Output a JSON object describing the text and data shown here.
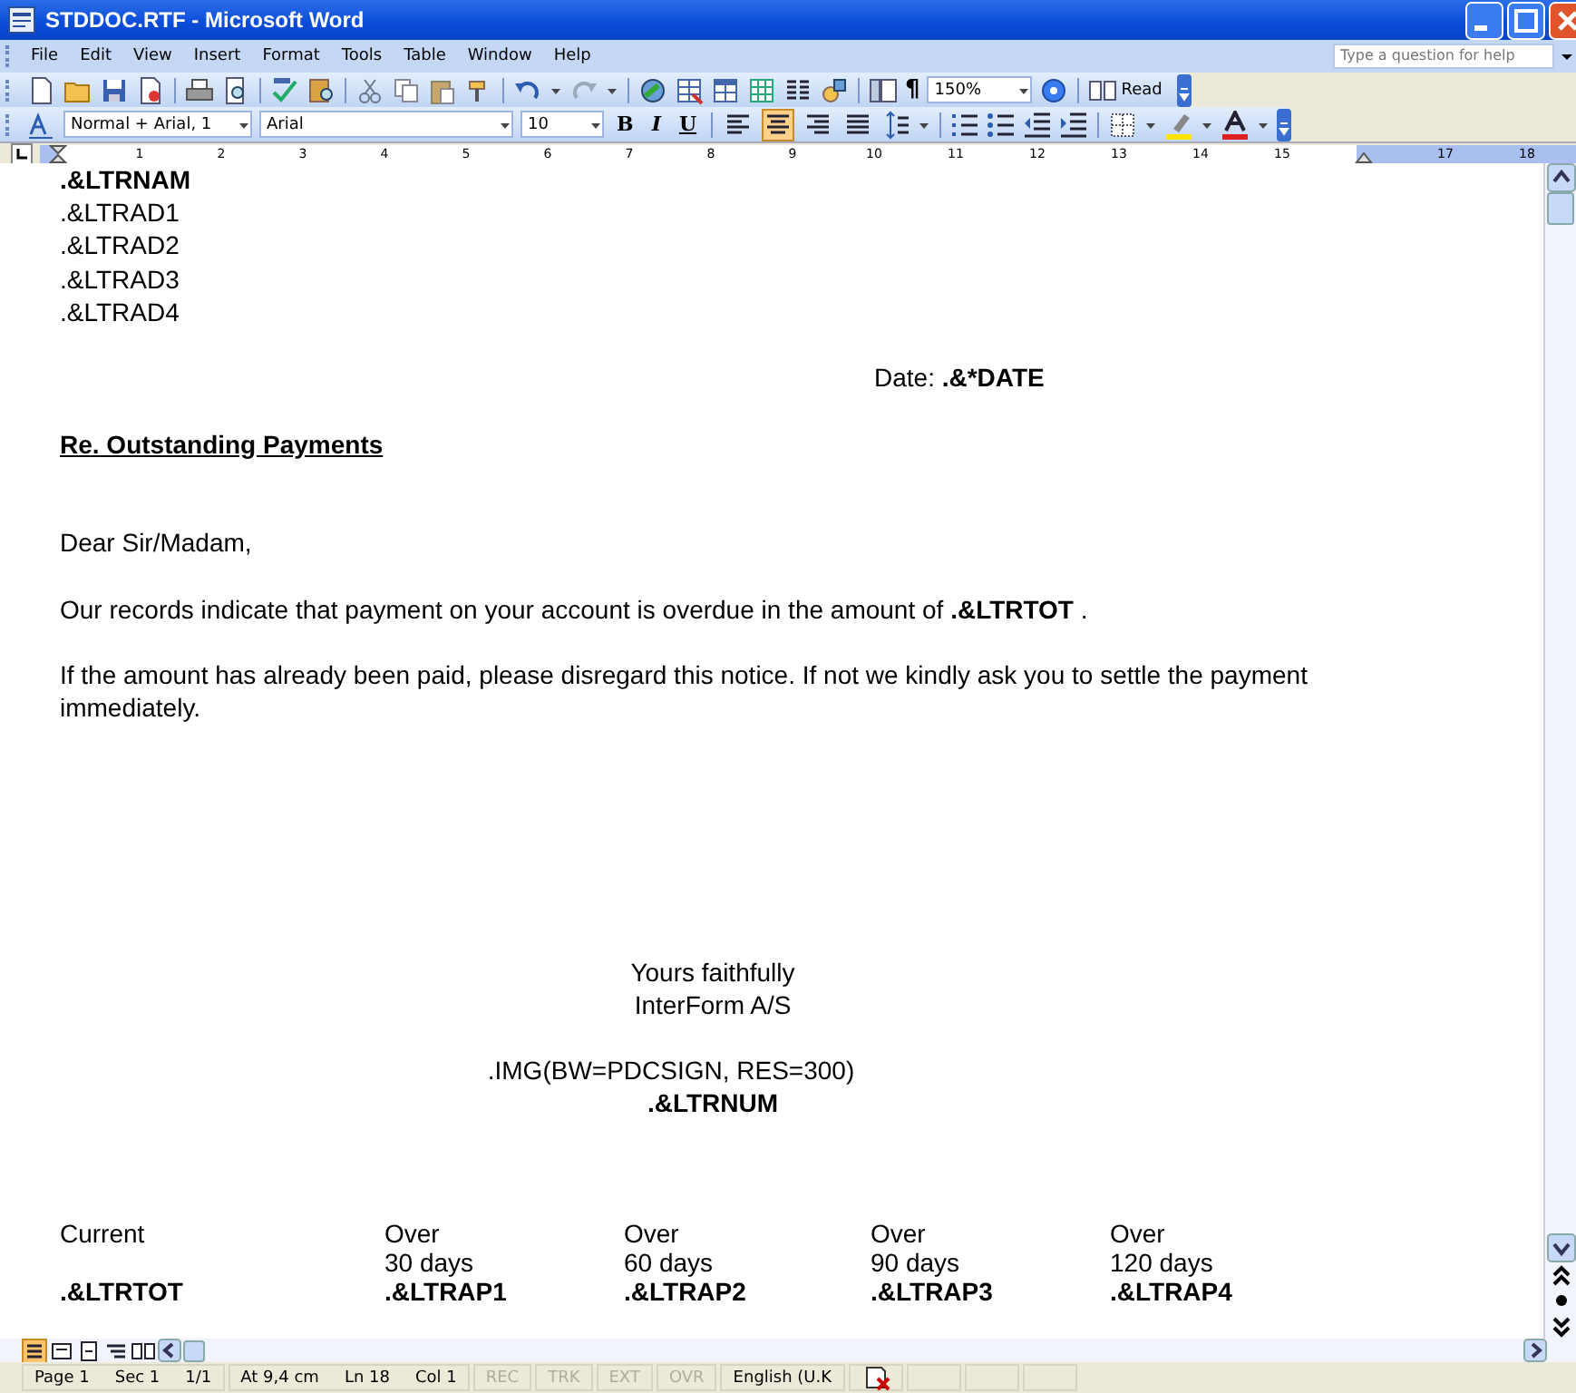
{
  "window": {
    "title": "STDDOC.RTF - Microsoft Word"
  },
  "menu": [
    "File",
    "Edit",
    "View",
    "Insert",
    "Format",
    "Tools",
    "Table",
    "Window",
    "Help"
  ],
  "help_box": {
    "placeholder": "Type a question for help"
  },
  "standard_toolbar": {
    "pilcrow": "¶",
    "zoom": "150%",
    "read": "Read"
  },
  "formatting_toolbar": {
    "style": "Normal + Arial, 1",
    "font": "Arial",
    "size": "10",
    "bold": "B",
    "italic": "I",
    "underline": "U",
    "align_buttons": [
      {
        "selected": false
      },
      {
        "selected": true
      },
      {
        "selected": false
      },
      {
        "selected": false
      }
    ]
  },
  "ruler": [
    "1",
    "2",
    "3",
    "4",
    "5",
    "6",
    "7",
    "8",
    "9",
    "10",
    "11",
    "12",
    "13",
    "14",
    "15",
    "17",
    "18"
  ],
  "document": {
    "paragraphs": [
      {
        "kind": "line",
        "text": ".&LTRNAM",
        "bold": true
      },
      {
        "kind": "line",
        "text": ".&LTRAD1",
        "bold": false
      },
      {
        "kind": "line",
        "text": ".&LTRAD2",
        "bold": false
      },
      {
        "kind": "line",
        "text": ".&LTRAD3",
        "bold": false
      },
      {
        "kind": "line",
        "text": ".&LTRAD4",
        "bold": false
      },
      {
        "kind": "empty"
      },
      {
        "kind": "date",
        "text": "Date: **.&*DATE**",
        "bold": false
      },
      {
        "kind": "empty"
      },
      {
        "kind": "heading",
        "text": "Re. Outstanding Payments",
        "bold": true
      },
      {
        "kind": "empty"
      },
      {
        "kind": "empty"
      },
      {
        "kind": "line",
        "text": "Dear Sir/Madam,",
        "bold": false
      },
      {
        "kind": "empty"
      },
      {
        "kind": "line",
        "text": "Our records indicate that payment on your account is overdue in the amount of **.&LTRTOT** .",
        "bold": false
      },
      {
        "kind": "empty"
      },
      {
        "kind": "line",
        "text": "If the amount has already been paid, please disregard this notice. If not we kindly ask you to settle the payment immediately.",
        "bold": false
      },
      {
        "kind": "empty"
      },
      {
        "kind": "empty"
      },
      {
        "kind": "empty"
      },
      {
        "kind": "empty"
      },
      {
        "kind": "empty"
      },
      {
        "kind": "empty"
      },
      {
        "kind": "empty"
      },
      {
        "kind": "center",
        "text": "Yours faithfully",
        "bold": false
      },
      {
        "kind": "center",
        "text": "InterForm A/S",
        "bold": false
      },
      {
        "kind": "empty"
      },
      {
        "kind": "image",
        "text": ".IMG(BW=PDCSIGN, RES=300)",
        "bold": false
      },
      {
        "kind": "center",
        "text": ".&LTRNUM",
        "bold": true
      },
      {
        "kind": "empty"
      },
      {
        "kind": "empty"
      },
      {
        "kind": "empty"
      }
    ],
    "aging_table": [
      {
        "label": [
          "Current"
        ],
        "value": ".&LTRTOT"
      },
      {
        "label": [
          "Over",
          "30 days"
        ],
        "value": ".&LTRAP1"
      },
      {
        "label": [
          "Over",
          "60 days"
        ],
        "value": ".&LTRAP2"
      },
      {
        "label": [
          "Over",
          "90 days"
        ],
        "value": ".&LTRAP3"
      },
      {
        "label": [
          "Over",
          "120 days"
        ],
        "value": ".&LTRAP4"
      }
    ]
  },
  "view_buttons": [
    {
      "selected": true
    },
    {
      "selected": false
    },
    {
      "selected": false
    },
    {
      "selected": false
    },
    {
      "selected": false
    }
  ],
  "status_bar": [
    {
      "text": "Page 1",
      "disabled": false
    },
    {
      "text": "Sec 1",
      "disabled": false
    },
    {
      "text": "1/1",
      "disabled": false
    },
    {
      "text": "At 9,4 cm",
      "disabled": false
    },
    {
      "text": "Ln 18",
      "disabled": false
    },
    {
      "text": "Col 1",
      "disabled": false
    },
    {
      "text": "REC",
      "disabled": true
    },
    {
      "text": "TRK",
      "disabled": true
    },
    {
      "text": "EXT",
      "disabled": true
    },
    {
      "text": "OVR",
      "disabled": true
    },
    {
      "text": "English (U.K",
      "disabled": false
    }
  ]
}
